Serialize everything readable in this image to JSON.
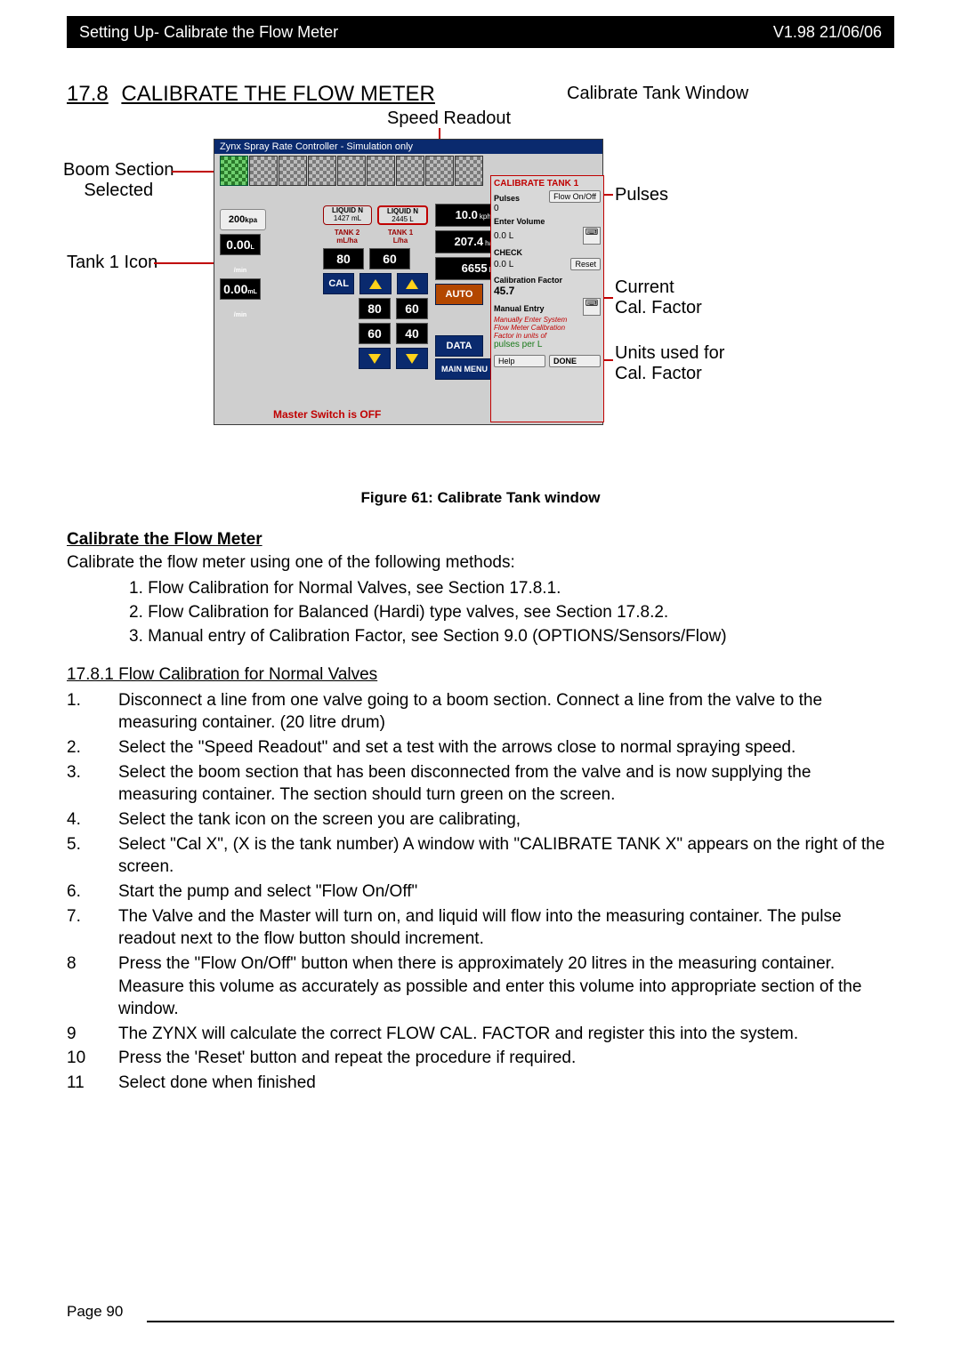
{
  "header": {
    "left": "Setting Up- Calibrate the Flow Meter",
    "right": "V1.98 21/06/06"
  },
  "section": {
    "num": "17.8",
    "title": "CALIBRATE THE FLOW METER"
  },
  "callouts": {
    "speed": "Speed Readout",
    "tankwin": "Calibrate Tank Window",
    "boom": "Boom Section\nSelected",
    "pulses": "Pulses",
    "tank1": "Tank 1 Icon",
    "calfac": "Current\nCal. Factor",
    "units": "Units used for\nCal. Factor"
  },
  "shot": {
    "title": "Zynx Spray Rate Controller  - Simulation only",
    "kpa": "200",
    "kpa_unit": "kpa",
    "liq2_hdr": "LIQUID N",
    "liq2_vol": "1427 mL",
    "liq1_hdr": "LIQUID N",
    "liq1_vol": "2445 L",
    "tank2_lbl": "TANK 2\nmL/ha",
    "tank1_lbl": "TANK 1\nL/ha",
    "t2a": "80",
    "t1a": "60",
    "cal": "CAL",
    "t2b": "80",
    "t1b": "60",
    "flow1": "0.00",
    "flow1u": "L\n/min",
    "t2c": "60",
    "t1c": "40",
    "flow2": "0.00",
    "flow2u": "mL\n/min",
    "speed": "10.0",
    "speed_u": "kph.",
    "area": "207.4",
    "area_u": "ha",
    "vol": "6655",
    "vol_u": "L",
    "auto": "AUTO",
    "data": "DATA",
    "mainmenu": "MAIN MENU",
    "status": "Master Switch is OFF"
  },
  "cal": {
    "hdr": "CALIBRATE TANK 1",
    "pulses_lbl": "Pulses",
    "flowbtn": "Flow On/Off",
    "pulses_val": "0",
    "enter_lbl": "Enter Volume",
    "enter_val": "0.0",
    "enter_unit": "L",
    "check_lbl": "CHECK",
    "check_val": "0.0",
    "check_unit": "L",
    "reset": "Reset",
    "fac_lbl": "Calibration Factor",
    "fac_val": "45.7",
    "manual": "Manual Entry",
    "note": "Manually Enter System\nFlow Meter Calibration\nFactor in units of",
    "units": "pulses per L",
    "help": "Help",
    "done": "DONE"
  },
  "figcap": "Figure 61:  Calibrate Tank window",
  "body": {
    "h1": "Calibrate the Flow Meter",
    "p1": "Calibrate the flow meter using one of the following methods:",
    "m1": "1. Flow Calibration for Normal Valves, see Section 17.8.1.",
    "m2": "2. Flow Calibration for Balanced (Hardi) type valves, see Section 17.8.2.",
    "m3": "3. Manual entry of Calibration Factor, see Section 9.0 (OPTIONS/Sensors/Flow)",
    "sub": "17.8.1  Flow Calibration for Normal Valves",
    "s1n": "1.",
    "s1": "Disconnect a line from one valve going to a boom section. Connect a line from the valve to the measuring container. (20 litre drum)",
    "s2n": "2.",
    "s2": "Select the \"Speed Readout\" and set a test with the arrows close to normal spraying speed.",
    "s3n": "3.",
    "s3": "Select the boom section that has been disconnected from the valve and is now supplying the measuring container. The section should turn green on the screen.",
    "s4n": "4.",
    "s4": "Select the tank icon on the screen you are calibrating,",
    "s5n": "5.",
    "s5": "Select \"Cal X\", (X is the tank number) A window with \"CALIBRATE TANK X\" appears on the right of the screen.",
    "s6n": "6.",
    "s6": "Start the pump and select \"Flow On/Off\"",
    "s7n": "7.",
    "s7": "The Valve and the Master will turn on, and liquid will flow into the measuring container.  The pulse readout next to the flow button should increment.",
    "s8n": "8",
    "s8": "Press the \"Flow On/Off\" button when there is approximately 20 litres in the measuring container. Measure this volume as accurately as possible and enter this volume into appropriate section of the window.",
    "s9n": "9",
    "s9": "The ZYNX will calculate the correct FLOW CAL. FACTOR and register this into the system.",
    "s10n": "10",
    "s10": "Press the 'Reset' button and repeat the procedure if required.",
    "s11n": "11",
    "s11": "Select done when finished"
  },
  "footer": {
    "page": "Page  90"
  }
}
